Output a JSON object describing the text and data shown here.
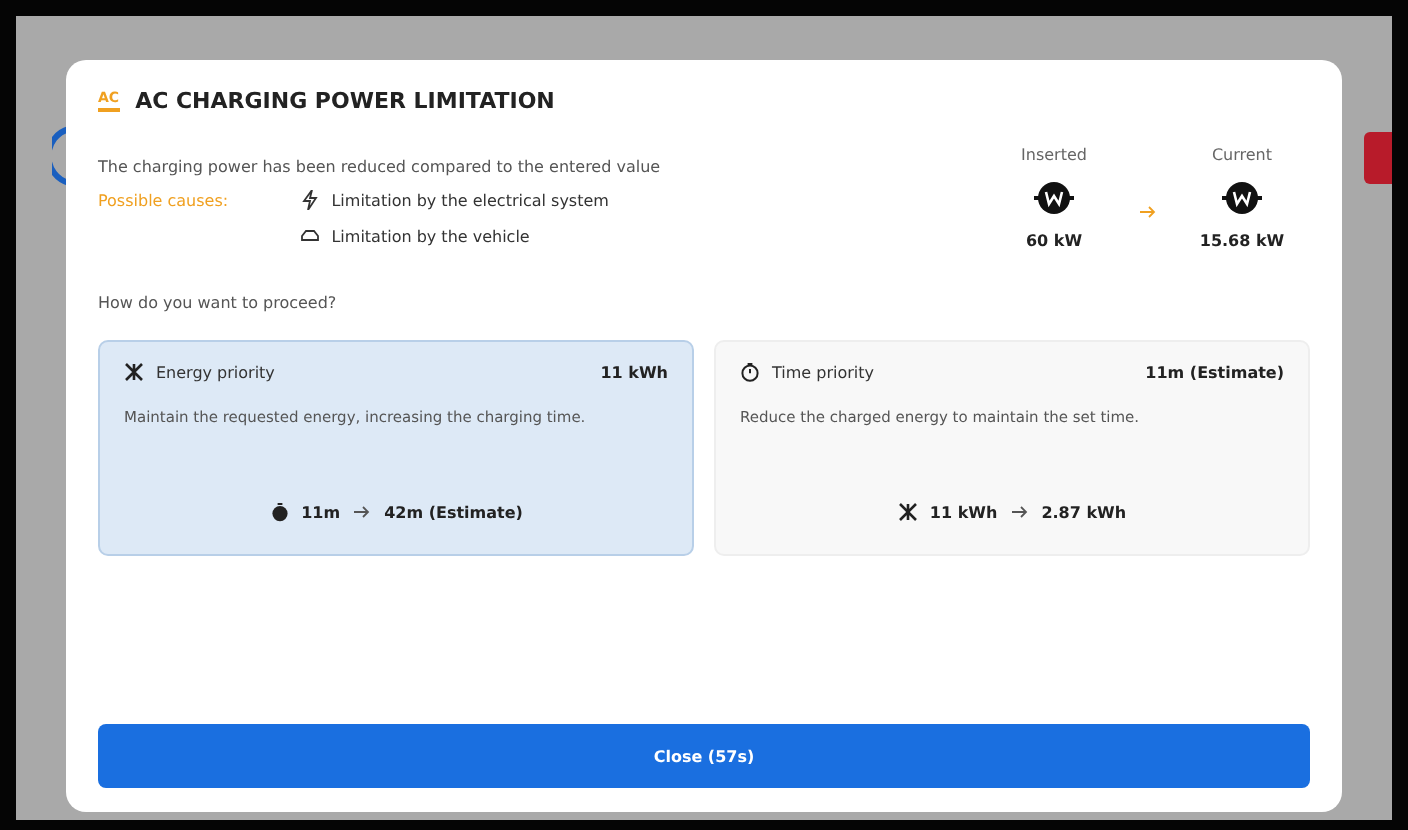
{
  "dialog": {
    "badge": "AC",
    "title": "AC CHARGING POWER LIMITATION",
    "message": "The charging power has been reduced compared to the entered value",
    "causes_label": "Possible causes:",
    "causes": [
      {
        "kind": "electrical",
        "text": "Limitation by the electrical system"
      },
      {
        "kind": "vehicle",
        "text": "Limitation by the vehicle"
      }
    ],
    "comparison": [
      {
        "label": "Inserted",
        "value": "60 kW"
      },
      {
        "label": "Current",
        "value": "15.68 kW"
      }
    ],
    "question": "How do you want to proceed?",
    "options": [
      {
        "kind": "energy",
        "title": "Energy priority",
        "amount": "11 kWh",
        "description": "Maintain the requested energy, increasing the charging time.",
        "from": "11m",
        "to": "42m (Estimate)",
        "selected": true
      },
      {
        "kind": "time",
        "title": "Time priority",
        "amount": "11m (Estimate)",
        "description": "Reduce the charged energy to maintain the set time.",
        "from": "11 kWh",
        "to": "2.87 kWh",
        "selected": false
      }
    ],
    "close_button": "Close (57s)"
  }
}
